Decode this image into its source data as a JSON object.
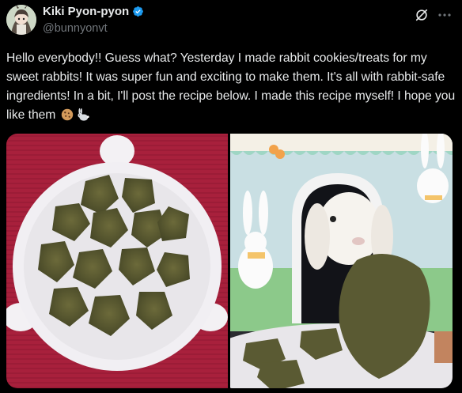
{
  "author": {
    "display_name": "Kiki Pyon-pyon",
    "handle": "@bunnyonvt",
    "verified": true
  },
  "tweet": {
    "text": "Hello everybody!! Guess what? Yesterday I made rabbit cookies/treats for my sweet rabbits! It was super fun and exciting to make them. It's all with rabbit-safe ingredients! In a bit, I'll post the recipe below. I made this recipe myself! I hope you like them",
    "emojis": [
      "cookie-emoji",
      "rabbit-emoji"
    ]
  },
  "icons": {
    "grok": "grok-icon",
    "more": "more-icon",
    "verified": "verified-badge-icon"
  },
  "colors": {
    "background": "#000000",
    "text": "#e7e9ea",
    "secondary": "#71767b",
    "verified": "#1d9bf0"
  },
  "media": [
    {
      "name": "cookies-on-plate-photo"
    },
    {
      "name": "rabbit-in-box-photo"
    }
  ]
}
